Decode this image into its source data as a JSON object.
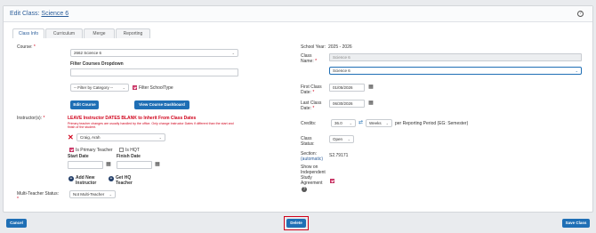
{
  "header": {
    "title_prefix": "Edit Class:",
    "class_name": "Science 6",
    "help_label": "?"
  },
  "tabs": [
    "Class Info",
    "Curriculum",
    "Merge",
    "Reporting"
  ],
  "left": {
    "course_label": "Course:",
    "course_value": "2662 Science 6",
    "filter_dropdown_label": "Filter Courses Dropdown",
    "filter_category_value": "-- Filter by Category --",
    "filter_schooltype_label": "Filter SchoolType",
    "edit_course": "Edit Course",
    "view_dashboard": "View Course Dashboard",
    "instructors_label": "Instructor(s):",
    "leave_blank": "LEAVE Instructor DATES BLANK to Inherit From Class Dates",
    "leave_note": "Primary teacher changes are usually handled by the office. Only change Instructor Dates if different than the start and finish of the student.",
    "instructor_value": "Craig, Arah",
    "primary_teacher": "Is Primary Teacher",
    "is_hqt": "Is HQT",
    "start_date": "Start Date",
    "finish_date": "Finish Date",
    "add_new": "Add New",
    "add_new2": "Instructor",
    "get_hq": "Get HQ",
    "get_hq2": "Teacher",
    "multi_label": "Multi-Teacher Status:",
    "multi_value": "Not Multi-Teacher"
  },
  "right": {
    "school_year_label": "School Year:",
    "school_year_value": "2025 - 2026",
    "class_name_label": "Class",
    "class_name_label2": "Name:",
    "class_name_value": "Science 6",
    "class_name_select": "Science 6",
    "first_date_label": "First Class",
    "first_date_label2": "Date:",
    "first_date_value": "01/05/2026",
    "last_date_label": "Last Class",
    "last_date_label2": "Date:",
    "last_date_value": "06/30/2026",
    "credits_label": "Credits:",
    "credits_value": "36.0",
    "weeks_value": "Weeks",
    "per_period": "per Reporting Period (EG: Semester)",
    "status_label": "Class",
    "status_label2": "Status:",
    "status_value": "Open",
    "section_label": "Section:",
    "section_auto": "(automatic)",
    "section_value": "S2.79171",
    "show_label1": "Show on",
    "show_label2": "Independent",
    "show_label3": "Study",
    "show_label4": "Agreement"
  },
  "footer": {
    "cancel": "Cancel",
    "delete": "Delete",
    "save": "Save Class"
  },
  "colors": {
    "accent": "#1f6fb5",
    "required": "#d0021b",
    "checkbox": "#e0487a"
  }
}
